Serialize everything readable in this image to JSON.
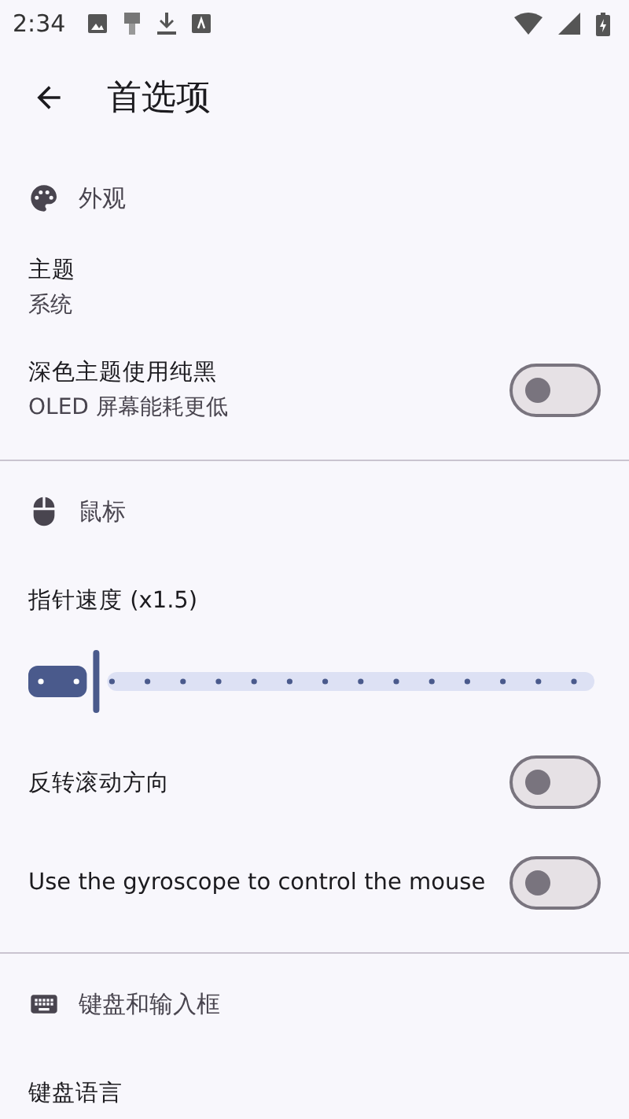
{
  "status_bar": {
    "time": "2:34"
  },
  "app_bar": {
    "title": "首选项"
  },
  "sections": [
    {
      "kind": "palette",
      "title": "外观",
      "items": [
        {
          "kind": "text",
          "title": "主题",
          "summary": "系统"
        },
        {
          "kind": "switch",
          "title": "深色主题使用纯黑",
          "summary": "OLED 屏幕能耗更低",
          "on": false
        }
      ]
    },
    {
      "kind": "mouse",
      "title": "鼠标",
      "items": [
        {
          "kind": "slider",
          "title": "指针速度 (x1.5)",
          "level": 0.12
        },
        {
          "kind": "switch",
          "title": "反转滚动方向",
          "on": false
        },
        {
          "kind": "switch",
          "title": "Use the gyroscope to control the mouse",
          "on": false
        }
      ]
    },
    {
      "kind": "keyboard",
      "title": "键盘和输入框",
      "items": [
        {
          "kind": "text",
          "title": "键盘语言"
        }
      ]
    }
  ]
}
